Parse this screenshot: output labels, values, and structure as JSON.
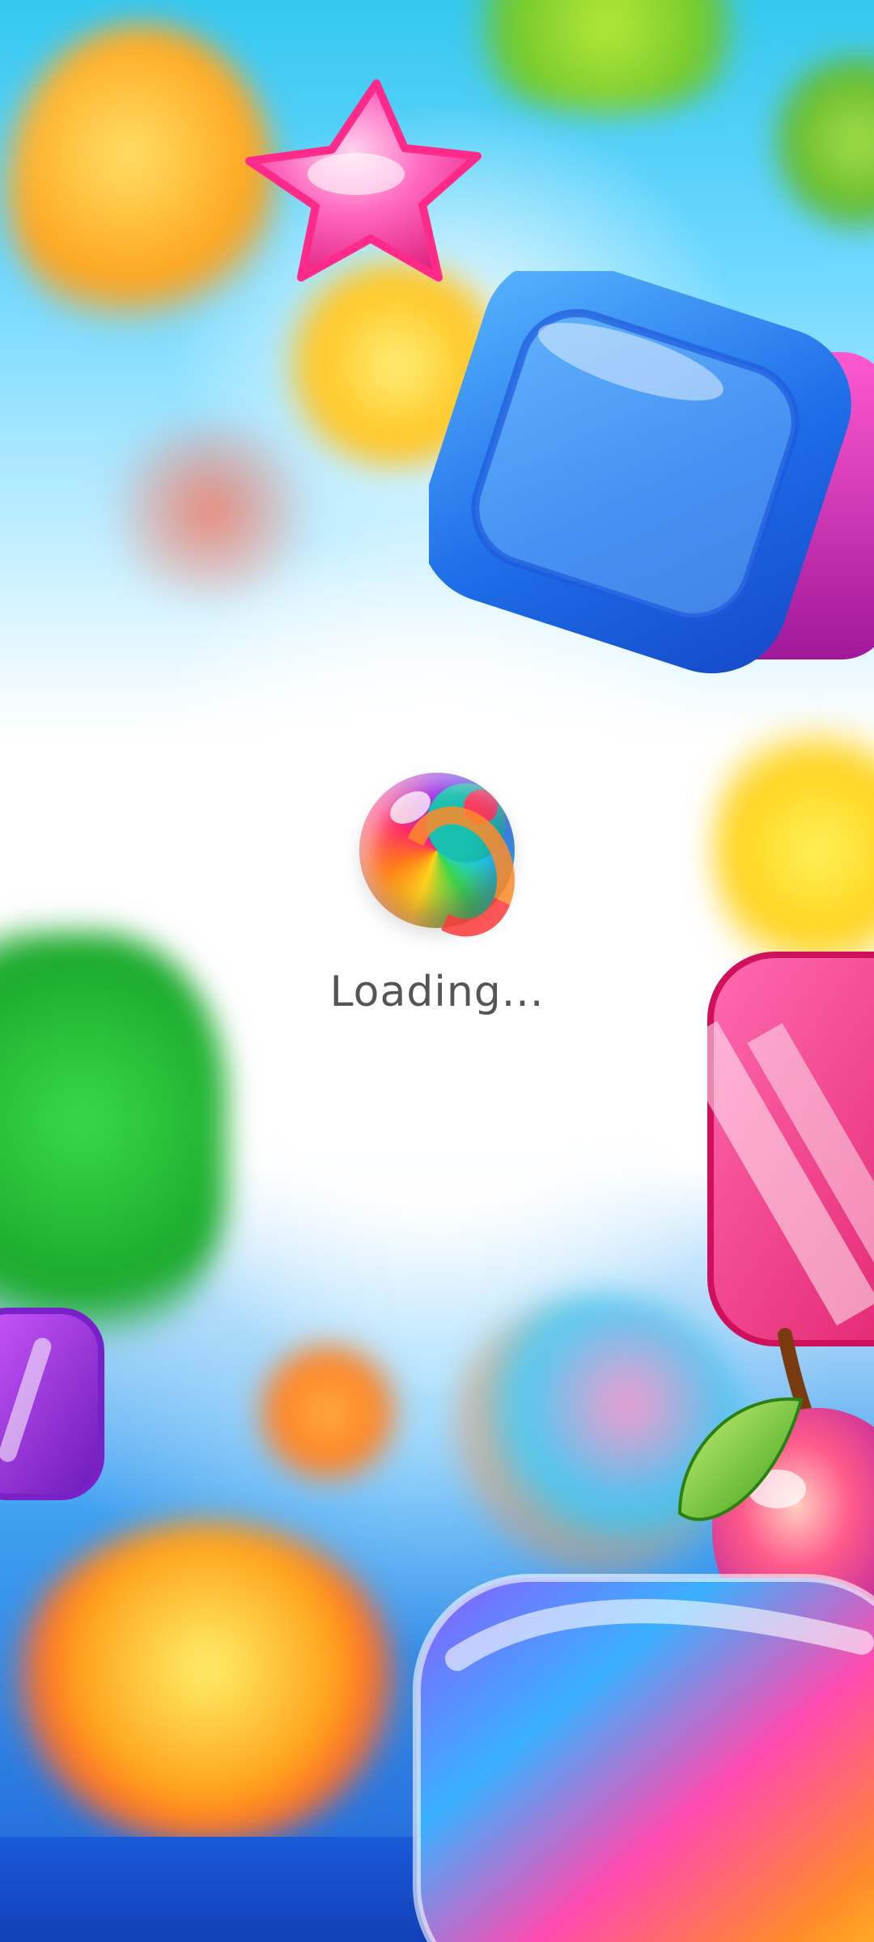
{
  "screen": {
    "loading_label": "Loading...",
    "loading_icon": "candy-ball-icon"
  },
  "colors": {
    "text": "#555555",
    "sky_top": "#35c8f0",
    "sky_bottom": "#1e63d8"
  }
}
